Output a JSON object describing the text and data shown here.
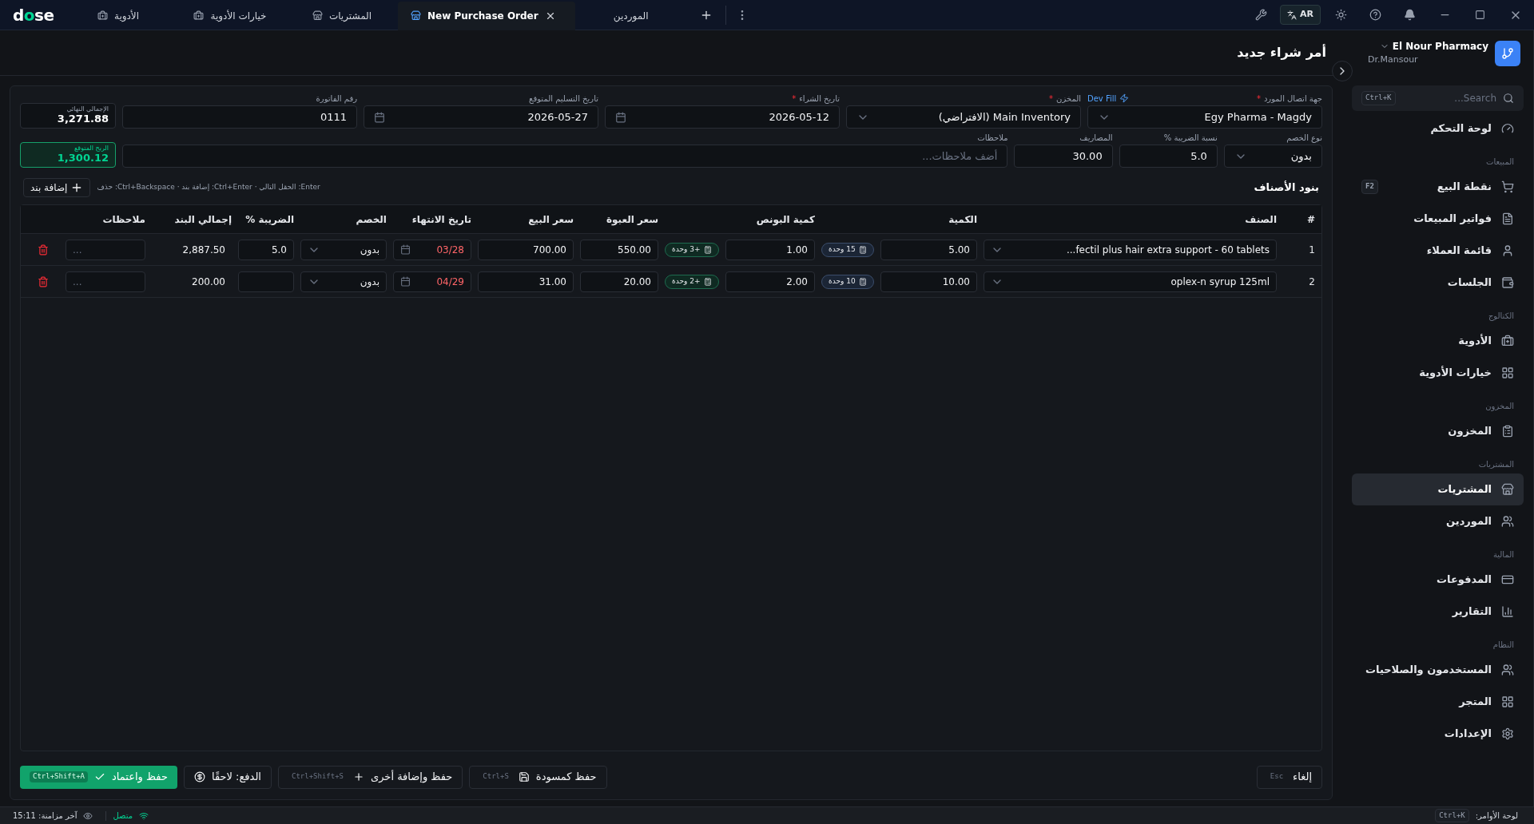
{
  "app": {
    "logo": "dose"
  },
  "tabs": [
    {
      "label": "الموردين",
      "kind": "plain",
      "selected": false
    },
    {
      "label": "New Purchase Order",
      "kind": "store",
      "selected": true
    },
    {
      "label": "المشتريات",
      "kind": "store",
      "selected": false
    },
    {
      "label": "خيارات الأدوية",
      "kind": "medicine",
      "selected": false
    },
    {
      "label": "الأدوية",
      "kind": "medicine",
      "selected": false
    }
  ],
  "toolbar": {
    "language": "AR"
  },
  "page": {
    "title": "أمر شراء جديد"
  },
  "account": {
    "pharmacy": "El Nour Pharmacy",
    "user": "Dr.Mansour"
  },
  "form": {
    "row_1": [
      {
        "kind": "select",
        "label": "جهة اتصال المورد",
        "required_mark": "*",
        "action": "Dev Fill",
        "value": "Egy Pharma - Magdy"
      },
      {
        "kind": "select",
        "label": "المخزن",
        "required_mark": "*",
        "value": "Main Inventory (الافتراضي)"
      },
      {
        "kind": "date",
        "label": "تاريخ الشراء",
        "required_mark": "*",
        "value": "2026-05-12"
      },
      {
        "kind": "date",
        "label": "تاريخ التسليم المتوقع",
        "value": "2026-05-27"
      },
      {
        "kind": "text",
        "label": "رقم الفاتورة",
        "value": "0111"
      }
    ],
    "row_2": [
      {
        "kind": "select",
        "label": "نوع الخصم",
        "value": "بدون"
      },
      {
        "kind": "text",
        "label": "نسبة الضريبة %",
        "value": "5.0"
      },
      {
        "kind": "text",
        "label": "المصاريف",
        "value": "30.00"
      },
      {
        "kind": "notes",
        "label": "ملاحظات",
        "placeholder": "أضف ملاحظات..."
      }
    ],
    "summary": [
      {
        "kind": "total",
        "label": "الإجمالي النهائي",
        "value": "3,271.88"
      },
      {
        "kind": "profit",
        "label": "الربح المتوقع",
        "value": "1,300.12"
      }
    ]
  },
  "items": {
    "title": "بنود الأصناف",
    "hint": "Enter: الحقل التالي · Ctrl+Enter: إضافة بند · Ctrl+Backspace: حذف",
    "add_button": "إضافة بند",
    "columns": [
      "#",
      "الصنف",
      "الكمية",
      "كمية البونص",
      "سعر العبوة",
      "سعر البيع",
      "تاريخ الانتهاء",
      "الخصم",
      "الضريبة %",
      "إجمالي البند",
      "ملاحظات"
    ],
    "rows": [
      {
        "index": "1",
        "item": "...fectil plus hair extra support - 60 tablets",
        "quantity": "5.00",
        "units": "15 وحدة",
        "bonus": "1.00",
        "bonus_units": "+3 وحدة",
        "pack_price": "550.00",
        "sell_price": "700.00",
        "expiry": "03/28",
        "expired": true,
        "discount": "بدون",
        "tax": "5.0",
        "total": "2,887.50",
        "notes_placeholder": "..."
      },
      {
        "index": "2",
        "item": "oplex-n syrup 125ml",
        "quantity": "10.00",
        "units": "10 وحدة",
        "bonus": "2.00",
        "bonus_units": "+2 وحدة",
        "pack_price": "20.00",
        "sell_price": "31.00",
        "expiry": "04/29",
        "expired": true,
        "discount": "بدون",
        "total": "200.00",
        "notes_placeholder": "..."
      }
    ]
  },
  "footer": [
    {
      "kind": "cancel",
      "label": "إلغاء",
      "shortcut": "Esc"
    },
    {
      "kind": "draft",
      "label": "حفظ كمسودة",
      "shortcut": "Ctrl+S"
    },
    {
      "kind": "save_add",
      "label": "حفظ وإضافة أخرى",
      "shortcut": "Ctrl+Shift+S"
    },
    {
      "kind": "payment",
      "label": "الدفع: لاحقًا"
    },
    {
      "kind": "approve",
      "label": "حفظ واعتماد",
      "shortcut": "Ctrl+Shift+A"
    }
  ],
  "sidebar": {
    "search_placeholder": "Search...",
    "search_shortcut": "Ctrl+K",
    "groups": [
      {
        "items": [
          {
            "kind": "dashboard",
            "label": "لوحة التحكم",
            "selected": false
          }
        ]
      },
      {
        "title": "المبيعات",
        "items": [
          {
            "kind": "cart",
            "label": "نقطة البيع",
            "selected": false,
            "shortcut": "F2"
          },
          {
            "kind": "invoice",
            "label": "فواتير المبيعات",
            "selected": false
          },
          {
            "kind": "user",
            "label": "قائمة العملاء",
            "selected": false
          },
          {
            "kind": "wallet",
            "label": "الجلسات",
            "selected": false
          }
        ]
      },
      {
        "title": "الكتالوج",
        "items": [
          {
            "kind": "medicine",
            "label": "الأدوية",
            "selected": false
          },
          {
            "kind": "grid",
            "label": "خيارات الأدوية",
            "selected": false
          }
        ]
      },
      {
        "title": "المخزون",
        "items": [
          {
            "kind": "clipboard",
            "label": "المخزون",
            "selected": false
          }
        ]
      },
      {
        "title": "المشتريات",
        "items": [
          {
            "kind": "store",
            "label": "المشتريات",
            "selected": true
          },
          {
            "kind": "users",
            "label": "الموردين",
            "selected": false
          }
        ]
      },
      {
        "title": "المالية",
        "items": [
          {
            "kind": "card",
            "label": "المدفوعات",
            "selected": false
          },
          {
            "kind": "chart",
            "label": "التقارير",
            "selected": false
          }
        ]
      },
      {
        "title": "النظام",
        "items": [
          {
            "kind": "users",
            "label": "المستخدمون والصلاحيات",
            "selected": false
          },
          {
            "kind": "grid",
            "label": "المتجر",
            "selected": false
          },
          {
            "kind": "settings",
            "label": "الإعدادات",
            "selected": false
          }
        ]
      }
    ]
  },
  "status_bar": {
    "sync": "آخر مزامنة: 15:11",
    "connection": "متصل",
    "command_label": "لوحة الأوامر:",
    "command_shortcut": "Ctrl+K"
  }
}
